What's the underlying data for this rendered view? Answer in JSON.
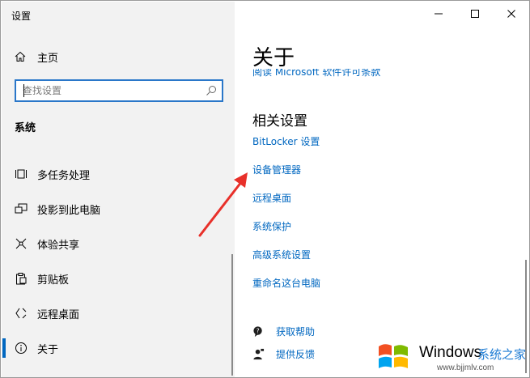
{
  "window": {
    "title": "设置"
  },
  "sidebar": {
    "home_label": "主页",
    "search": {
      "placeholder": "查找设置",
      "value": ""
    },
    "section_title": "系统",
    "items": [
      {
        "label": "多任务处理",
        "icon": "multitasking-icon",
        "selected": false
      },
      {
        "label": "投影到此电脑",
        "icon": "project-icon",
        "selected": false
      },
      {
        "label": "体验共享",
        "icon": "shared-experiences-icon",
        "selected": false
      },
      {
        "label": "剪贴板",
        "icon": "clipboard-icon",
        "selected": false
      },
      {
        "label": "远程桌面",
        "icon": "remote-desktop-icon",
        "selected": false
      },
      {
        "label": "关于",
        "icon": "info-icon",
        "selected": true
      }
    ]
  },
  "main": {
    "title": "关于",
    "clipped_link": "阅读 Microsoft 软件许可条款",
    "related_title": "相关设置",
    "related_links": [
      "BitLocker 设置",
      "设备管理器",
      "远程桌面",
      "系统保护",
      "高级系统设置",
      "重命名这台电脑"
    ],
    "help": {
      "get_help": "获取帮助",
      "feedback": "提供反馈"
    }
  },
  "watermark": {
    "brand": "Windows",
    "cn": "系统之家",
    "url": "www.bjjmlv.com"
  },
  "colors": {
    "accent": "#0067c0",
    "arrow": "#e8302a",
    "sidebar_bg": "#f2f2f2"
  }
}
